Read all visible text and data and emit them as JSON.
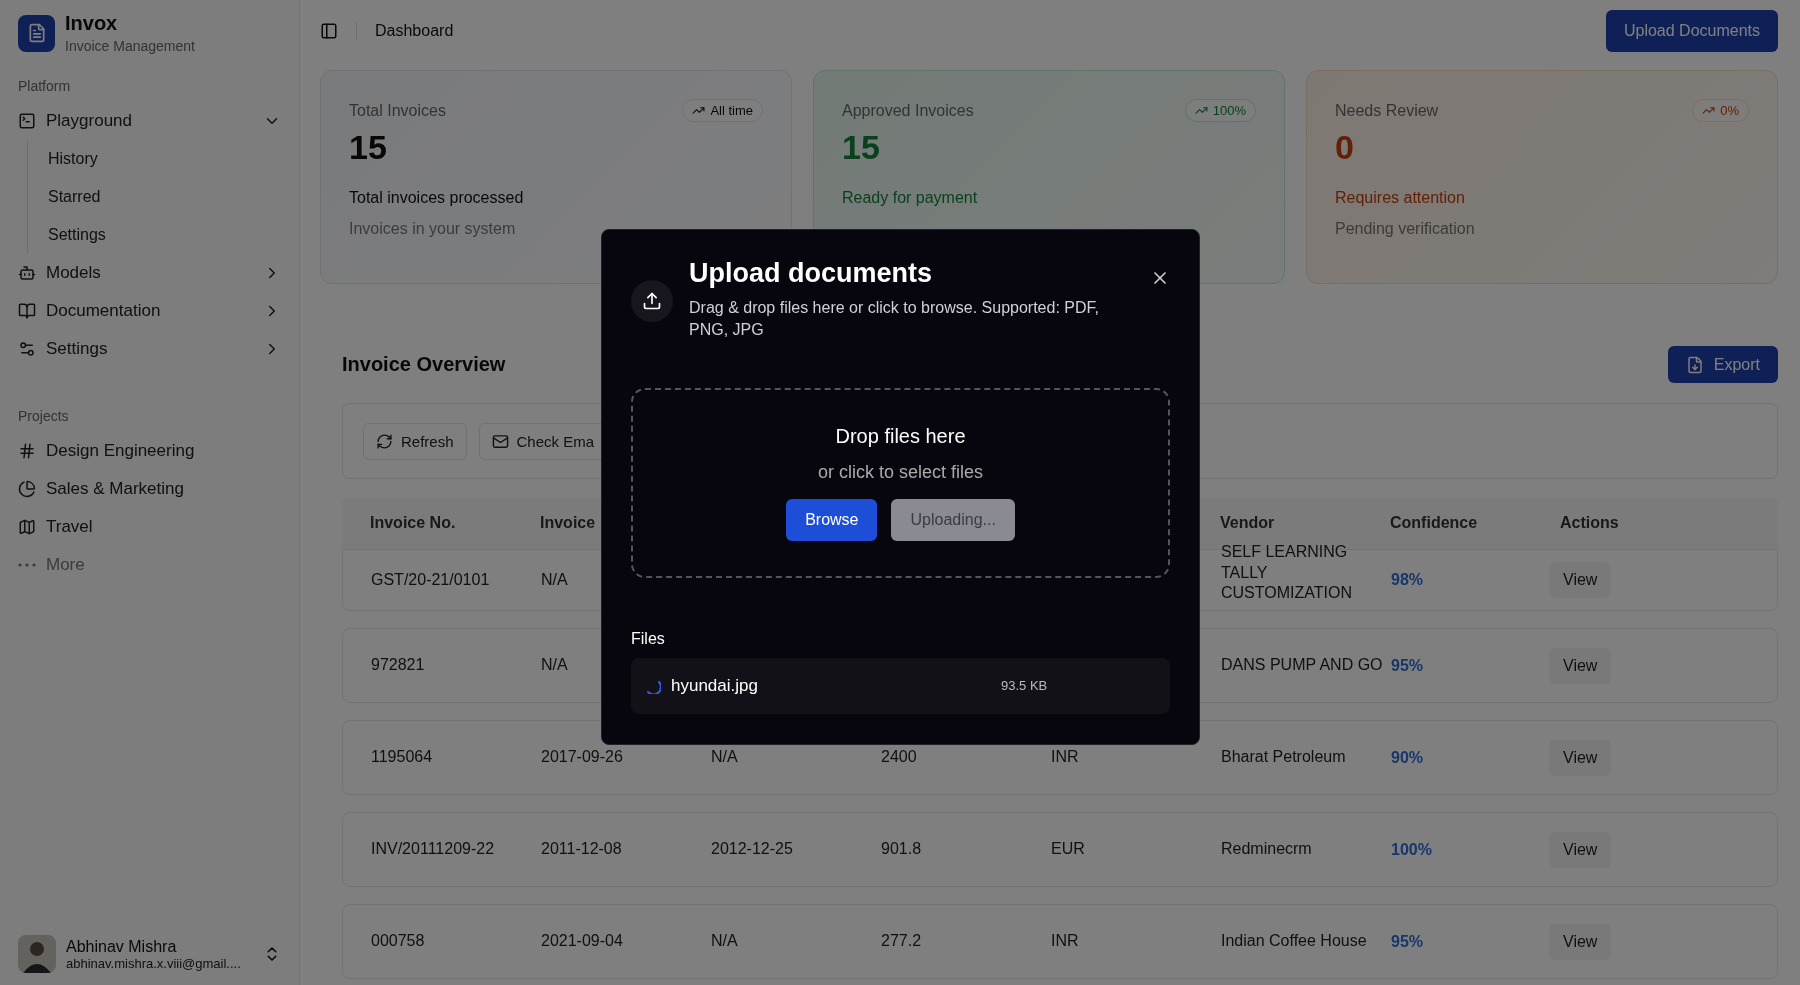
{
  "app": {
    "name": "Invox",
    "subtitle": "Invoice Management"
  },
  "sidebar": {
    "sections": [
      {
        "title": "Platform",
        "items": [
          {
            "label": "Playground",
            "expanded": true,
            "children": [
              {
                "label": "History"
              },
              {
                "label": "Starred"
              },
              {
                "label": "Settings"
              }
            ]
          },
          {
            "label": "Models",
            "expanded": false
          },
          {
            "label": "Documentation",
            "expanded": false
          },
          {
            "label": "Settings",
            "expanded": false
          }
        ]
      },
      {
        "title": "Projects",
        "items": [
          {
            "label": "Design Engineering"
          },
          {
            "label": "Sales & Marketing"
          },
          {
            "label": "Travel"
          },
          {
            "label": "More",
            "kind": "more"
          }
        ]
      }
    ],
    "user": {
      "name": "Abhinav Mishra",
      "email": "abhinav.mishra.x.viii@gmail...."
    }
  },
  "header": {
    "breadcrumb": "Dashboard",
    "action": "Upload Documents"
  },
  "cards": [
    {
      "kind": "neutral",
      "title": "Total Invoices",
      "badge": "All time",
      "value": "15",
      "line1": "Total invoices processed",
      "line2": "Invoices in your system"
    },
    {
      "kind": "success",
      "title": "Approved Invoices",
      "badge": "100%",
      "value": "15",
      "line1": "Ready for payment"
    },
    {
      "kind": "warning",
      "title": "Needs Review",
      "badge": "0%",
      "value": "0",
      "line1": "Requires attention",
      "line2": "Pending verification"
    }
  ],
  "overview": {
    "title": "Invoice Overview",
    "export": "Export",
    "toolbar": [
      "Refresh",
      "Check Ema"
    ]
  },
  "table": {
    "columns": [
      "Invoice No.",
      "Invoice",
      null,
      null,
      null,
      "Vendor",
      "Confidence",
      "Actions"
    ],
    "rows": [
      {
        "cells": [
          "GST/20-21/0101",
          "N/A",
          null,
          null,
          null,
          "SELF LEARNING TALLY CUSTOMIZATION",
          "98%",
          "View"
        ]
      },
      {
        "cells": [
          "972821",
          "N/A",
          null,
          null,
          null,
          "DANS PUMP AND GO",
          "95%",
          "View"
        ]
      },
      {
        "cells": [
          "1195064",
          "2017-09-26",
          "N/A",
          "2400",
          "INR",
          "Bharat Petroleum",
          "90%",
          "View"
        ]
      },
      {
        "cells": [
          "INV/20111209-22",
          "2011-12-08",
          "2012-12-25",
          "901.8",
          "EUR",
          "Redminecrm",
          "100%",
          "View"
        ]
      },
      {
        "cells": [
          "000758",
          "2021-09-04",
          "N/A",
          "277.2",
          "INR",
          "Indian Coffee House",
          "95%",
          "View"
        ]
      }
    ]
  },
  "dialog": {
    "title": "Upload documents",
    "description": "Drag & drop files here or click to browse. Supported: PDF, PNG, JPG",
    "drop_title": "Drop files here",
    "drop_hint": "or click to select files",
    "browse": "Browse",
    "upload": "Uploading...",
    "upload_disabled": true,
    "files_label": "Files",
    "files": [
      {
        "name": "hyundai.jpg",
        "size": "93.5 KB",
        "uploading": true
      }
    ]
  }
}
